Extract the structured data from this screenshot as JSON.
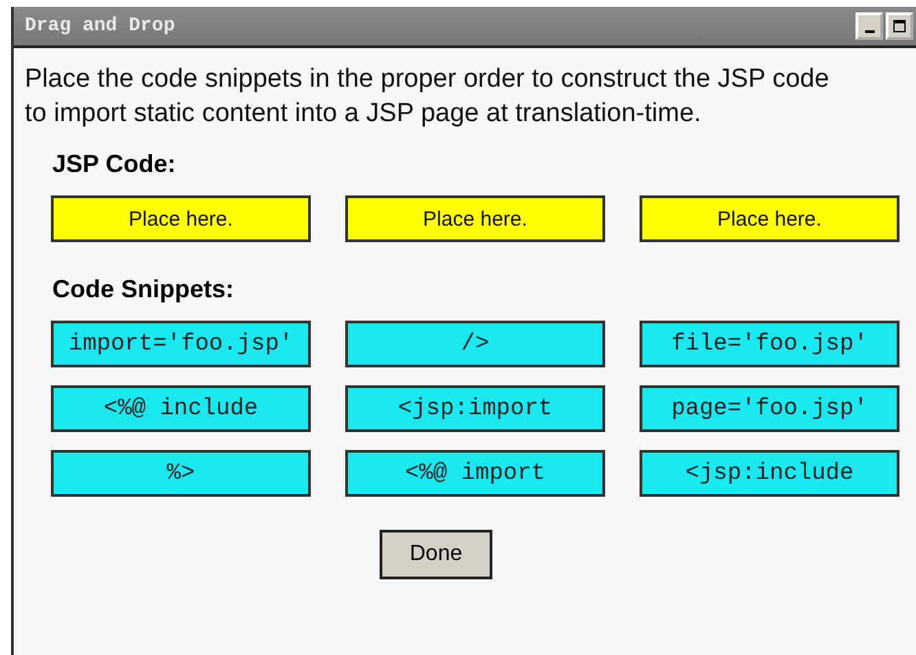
{
  "window": {
    "title": "Drag and Drop"
  },
  "instructions": "Place the code snippets in the proper order to construct the JSP code to import static content into a JSP page at translation-time.",
  "jsp_code": {
    "heading": "JSP Code:",
    "slots": [
      "Place here.",
      "Place here.",
      "Place here."
    ]
  },
  "code_snippets": {
    "heading": "Code Snippets:",
    "items": [
      "import='foo.jsp'",
      "/>",
      "file='foo.jsp'",
      "<%@ include",
      "<jsp:import",
      "page='foo.jsp'",
      "%>",
      "<%@ import",
      "<jsp:include"
    ]
  },
  "buttons": [
    "Done"
  ]
}
